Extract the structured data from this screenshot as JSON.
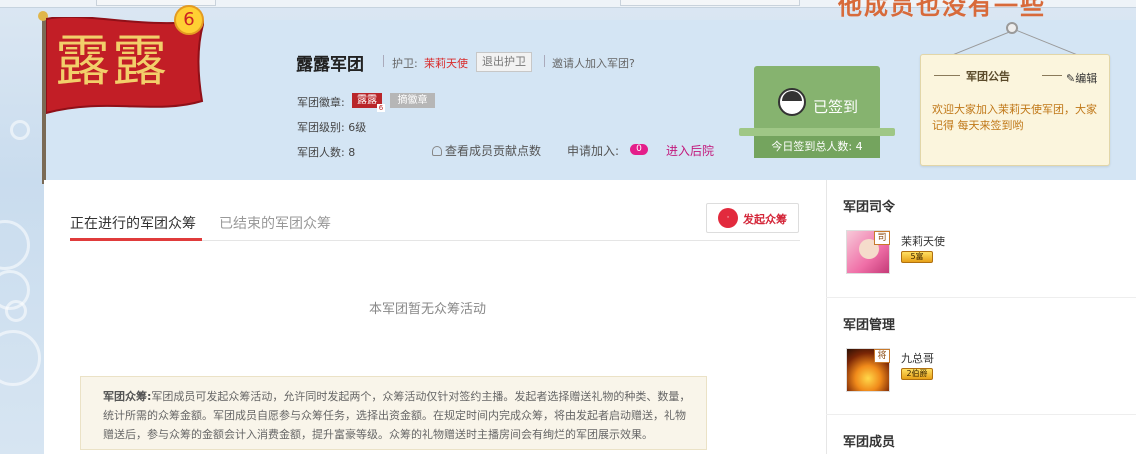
{
  "page_overlay_text": "他成员也没有一些",
  "header": {
    "flag_text": "露露",
    "level": "6",
    "legion_name": "露露军团",
    "guard_label": "护卫:",
    "guard_name": "茉莉天使",
    "quit_guard": "退出护卫",
    "invite": "邀请人加入军团?",
    "emblem_label": "军团徽章:",
    "emblem_text": "露露",
    "emblem_level": "6",
    "pick_emblem": "摘徽章",
    "level_label": "军团级别: 6级",
    "members_label": "军团人数: 8",
    "view_contribution": "查看成员贡献点数",
    "apply_join_label": "申请加入:",
    "apply_join_count": "0",
    "enter_backyard": "进入后院"
  },
  "signin": {
    "status": "已签到",
    "total_today": "今日签到总人数: 4"
  },
  "notice": {
    "title": "军团公告",
    "edit": "✎编辑",
    "body": "欢迎大家加入茉莉天使军团，大家记得 每天来签到哟"
  },
  "tabs": {
    "active": "正在进行的军团众筹",
    "ended": "已结束的军团众筹"
  },
  "start_crowdfund": {
    "icon_text": "·",
    "label": "发起众筹"
  },
  "empty_message": "本军团暂无众筹活动",
  "description": {
    "title": "军团众筹:",
    "body": "军团成员可发起众筹活动，允许同时发起两个，众筹活动仅针对签约主播。发起者选择赠送礼物的种类、数量，统计所需的众筹金额。军团成员自愿参与众筹任务，选择出资金额。在规定时间内完成众筹，将由发起者启动赠送，礼物赠送后，参与众筹的金额会计入消费金额，提升富豪等级。众筹的礼物赠送时主播房间会有绚烂的军团展示效果。"
  },
  "sidebar": {
    "commander_title": "军团司令",
    "commander": {
      "name": "茉莉天使",
      "tag": "司",
      "badge": "5富"
    },
    "management_title": "军团管理",
    "manager": {
      "name": "九总哥",
      "tag": "将",
      "badge": "2伯爵"
    },
    "members_title": "军团成员"
  },
  "colors": {
    "accent_red": "#e03b3b",
    "signin_green": "#86b36f",
    "notice_bg": "#fbf5dd",
    "header_bg": "#d4e5f4",
    "flag_red": "#c21e26"
  }
}
